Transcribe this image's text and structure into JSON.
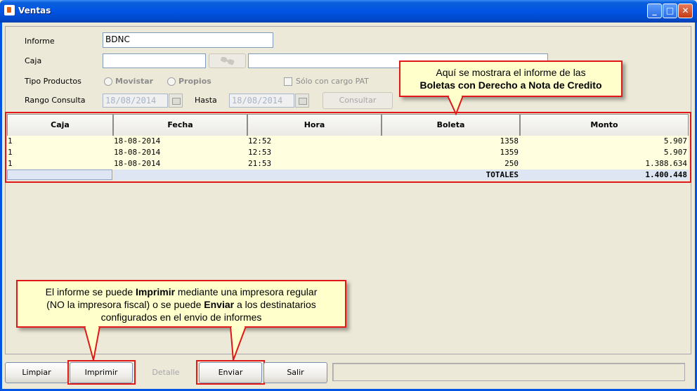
{
  "window": {
    "title": "Ventas"
  },
  "form": {
    "informe_label": "Informe",
    "informe_value": "BDNC",
    "caja_label": "Caja",
    "caja_value": "",
    "caja_desc_value": "",
    "tipo_productos_label": "Tipo Productos",
    "radio_movistar": "Movistar",
    "radio_propios": "Propios",
    "solo_cargo_pat": "Sólo con cargo PAT",
    "rango_consulta_label": "Rango Consulta",
    "fecha_desde": "18/08/2014",
    "hasta_label": "Hasta",
    "fecha_hasta": "18/08/2014",
    "consultar_button": "Consultar"
  },
  "table": {
    "columns": [
      "Caja",
      "Fecha",
      "Hora",
      "Boleta",
      "Monto"
    ],
    "rows": [
      [
        "1",
        "18-08-2014",
        "12:52",
        "1358",
        "5.907"
      ],
      [
        "1",
        "18-08-2014",
        "12:53",
        "1359",
        "5.907"
      ],
      [
        "1",
        "18-08-2014",
        "21:53",
        "250",
        "1.388.634"
      ]
    ],
    "totals_label": "TOTALES",
    "totals_value": "1.400.448"
  },
  "callouts": {
    "top_line1": "Aquí se mostrara el informe de las",
    "top_line2": "Boletas con Derecho a Nota de Credito",
    "bottom_p1": "El informe se puede ",
    "bottom_b1": "Imprimir",
    "bottom_p2": " mediante una impresora regular",
    "bottom_p3": "(NO la impresora fiscal) o se puede ",
    "bottom_b2": "Enviar",
    "bottom_p4": " a los destinatarios",
    "bottom_p5": "configurados en el envio de informes"
  },
  "buttons": {
    "limpiar": "Limpiar",
    "imprimir": "Imprimir",
    "detalle": "Detalle",
    "enviar": "Enviar",
    "salir": "Salir"
  },
  "status_text": ""
}
